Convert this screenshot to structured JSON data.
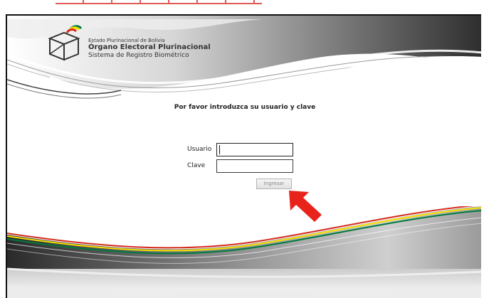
{
  "organization": {
    "line1": "Estado Plurinacional de Bolivia",
    "line2": "Órgano Electoral Plurinacional",
    "line3": "Sistema de Registro Biométrico"
  },
  "login": {
    "prompt": "Por favor introduzca su usuario y clave",
    "username_label": "Usuario",
    "username_value": "",
    "password_label": "Clave",
    "password_value": "",
    "submit_label": "Ingresar"
  },
  "icons": {
    "logo": "ballot-box-logo-icon",
    "annotation_arrow": "arrow-pointer-icon"
  },
  "colors": {
    "annotation_red": "#e8231c",
    "flag_red": "#d52b1e",
    "flag_yellow": "#f9e300",
    "flag_green": "#007a3d"
  }
}
